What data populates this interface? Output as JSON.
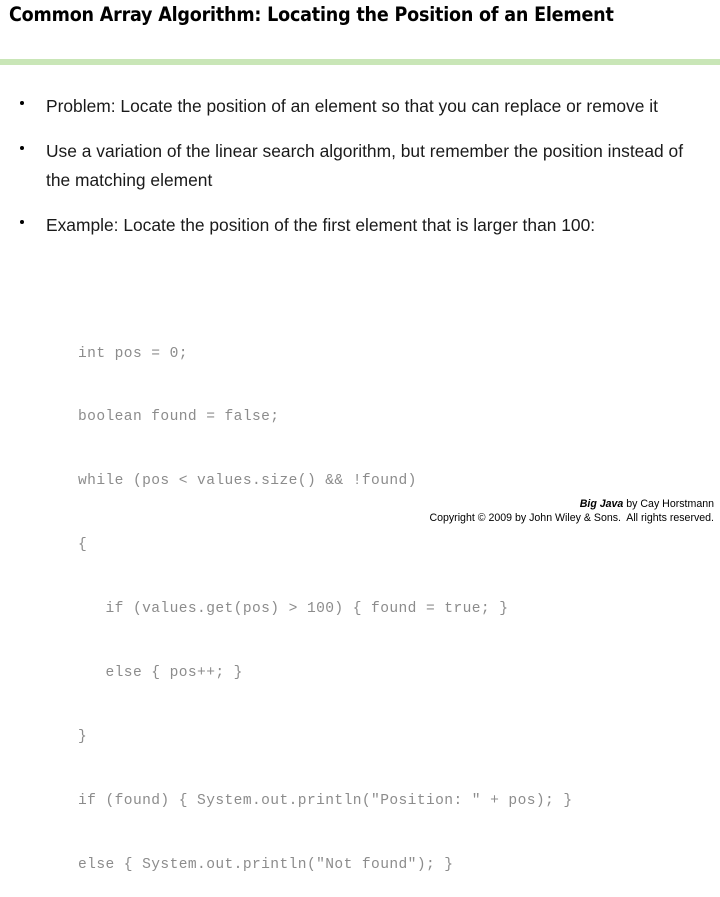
{
  "slide": {
    "title": "Common Array Algorithm: Locating the Position of an Element",
    "divider_color": "#c9e6b7",
    "background_color": "#ffffff"
  },
  "bullets": [
    {
      "marker": "bullet-dot",
      "text": "Problem: Locate the position of an element so that you can replace or remove it"
    },
    {
      "marker": "bullet-dot",
      "text": "Use a variation of the linear search algorithm, but remember the position instead of the matching element"
    },
    {
      "marker": "bullet-dot",
      "text": "Example: Locate the position of the first element that is larger than 100:"
    }
  ],
  "code": {
    "language": "java",
    "text_color": "#8c8c8c",
    "lines": [
      "int pos = 0;",
      "boolean found = false;",
      "while (pos < values.size() && !found)",
      "{",
      "   if (values.get(pos) > 100) { found = true; }",
      "   else { pos++; }",
      "}",
      "if (found) { System.out.println(\"Position: \" + pos); }",
      "else { System.out.println(\"Not found\"); }"
    ]
  },
  "footer": {
    "book_title": "Big Java",
    "book_attribution": " by Cay Horstmann",
    "copyright": "Copyright © 2009 by John Wiley & Sons.  All rights reserved."
  }
}
